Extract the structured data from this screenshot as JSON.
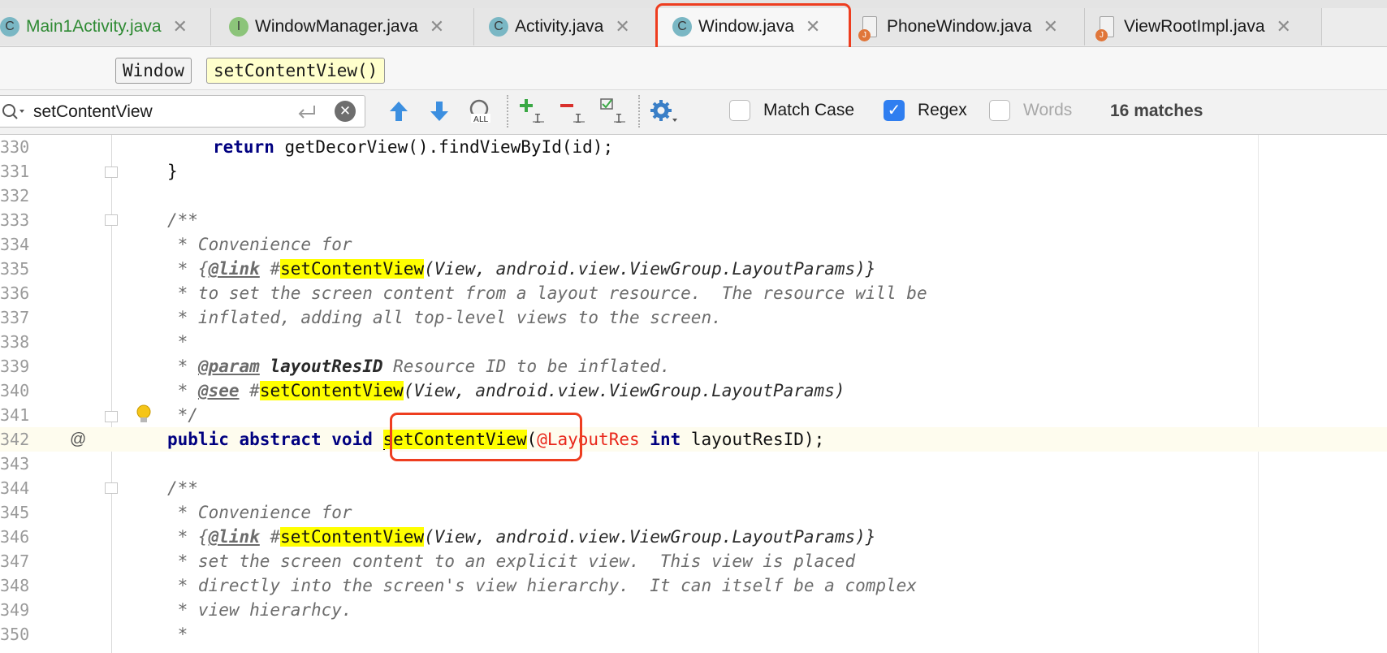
{
  "tabs": [
    {
      "label": "Main1Activity.java",
      "icon": "C",
      "color": "#2e8a33"
    },
    {
      "label": "WindowManager.java",
      "icon": "I"
    },
    {
      "label": "Activity.java",
      "icon": "C"
    },
    {
      "label": "Window.java",
      "icon": "C",
      "active": true
    },
    {
      "label": "PhoneWindow.java",
      "icon": "J"
    },
    {
      "label": "ViewRootImpl.java",
      "icon": "J"
    }
  ],
  "breadcrumbs": {
    "class": "Window",
    "method": "setContentView()"
  },
  "search": {
    "query": "setContentView",
    "options": {
      "match_case": {
        "label": "Match Case",
        "checked": false
      },
      "regex": {
        "label": "Regex",
        "checked": true
      },
      "words": {
        "label": "Words",
        "checked": false
      }
    },
    "matches": "16 matches"
  },
  "editor": {
    "line_numbers": [
      "330",
      "331",
      "332",
      "333",
      "334",
      "335",
      "336",
      "337",
      "338",
      "339",
      "340",
      "341",
      "342",
      "343",
      "344",
      "345",
      "346",
      "347",
      "348",
      "349",
      "350"
    ],
    "lines": {
      "l330": {
        "kw": "return",
        "rest": " getDecorView().findViewById(id);"
      },
      "l331": "}",
      "l333": "/**",
      "l334": " * Convenience for",
      "l335": {
        "pre": " * {",
        "tag": "@link",
        "hash": " #",
        "hl": "setContentView",
        "args": "(View, android.view.ViewGroup.LayoutParams)}"
      },
      "l336": " * to set the screen content from a layout resource.  The resource will be",
      "l337": " * inflated, adding all top-level views to the screen.",
      "l338": " *",
      "l339": {
        "pre": " * ",
        "tag": "@param",
        "name": " layoutResID",
        "desc": " Resource ID to be inflated."
      },
      "l340": {
        "pre": " * ",
        "tag": "@see",
        "hash": " #",
        "hl": "setContentView",
        "args": "(View, android.view.ViewGroup.LayoutParams)"
      },
      "l341": " */",
      "l342": {
        "kw1": "public abstract void",
        "hl": "setContentView",
        "open": "(",
        "ann": "@LayoutRes",
        "kw2": "int",
        "rest": " layoutResID);"
      },
      "l344": "/**",
      "l345": " * Convenience for",
      "l346": {
        "pre": " * {",
        "tag": "@link",
        "hash": " #",
        "hl": "setContentView",
        "args": "(View, android.view.ViewGroup.LayoutParams)}"
      },
      "l347": " * set the screen content to an explicit view.  This view is placed",
      "l348": " * directly into the screen's view hierarchy.  It can itself be a complex",
      "l349": " * view hierarhcy.",
      "l350": " *"
    },
    "gutter_mark": "@"
  },
  "colors": {
    "highlight_box": "#ee3d1f",
    "match": "#ffff00",
    "keyword": "#000080",
    "annotation": "#e8261a"
  }
}
